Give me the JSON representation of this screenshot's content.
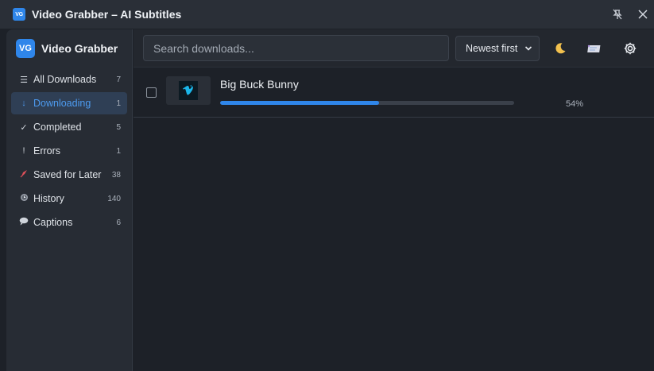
{
  "window": {
    "icon_text": "VG",
    "title": "Video Grabber – AI Subtitles"
  },
  "sidebar": {
    "logo_text": "VG",
    "app_name": "Video Grabber",
    "items": [
      {
        "icon": "list-icon",
        "label": "All Downloads",
        "count": "7"
      },
      {
        "icon": "download-arrow-icon",
        "label": "Downloading",
        "count": "1"
      },
      {
        "icon": "check-icon",
        "label": "Completed",
        "count": "5"
      },
      {
        "icon": "exclamation-icon",
        "label": "Errors",
        "count": "1"
      },
      {
        "icon": "bookmark-icon",
        "label": "Saved for Later",
        "count": "38"
      },
      {
        "icon": "history-icon",
        "label": "History",
        "count": "140"
      },
      {
        "icon": "speech-bubble-icon",
        "label": "Captions",
        "count": "6"
      }
    ],
    "active_index": 1
  },
  "toolbar": {
    "search_placeholder": "Search downloads...",
    "sort_value": "Newest first"
  },
  "downloads": [
    {
      "title": "Big Buck Bunny",
      "source": "vimeo",
      "progress_percent": 54,
      "progress_text": "54%"
    }
  ],
  "colors": {
    "accent": "#2f86ea",
    "active_text": "#4d9bf0"
  }
}
